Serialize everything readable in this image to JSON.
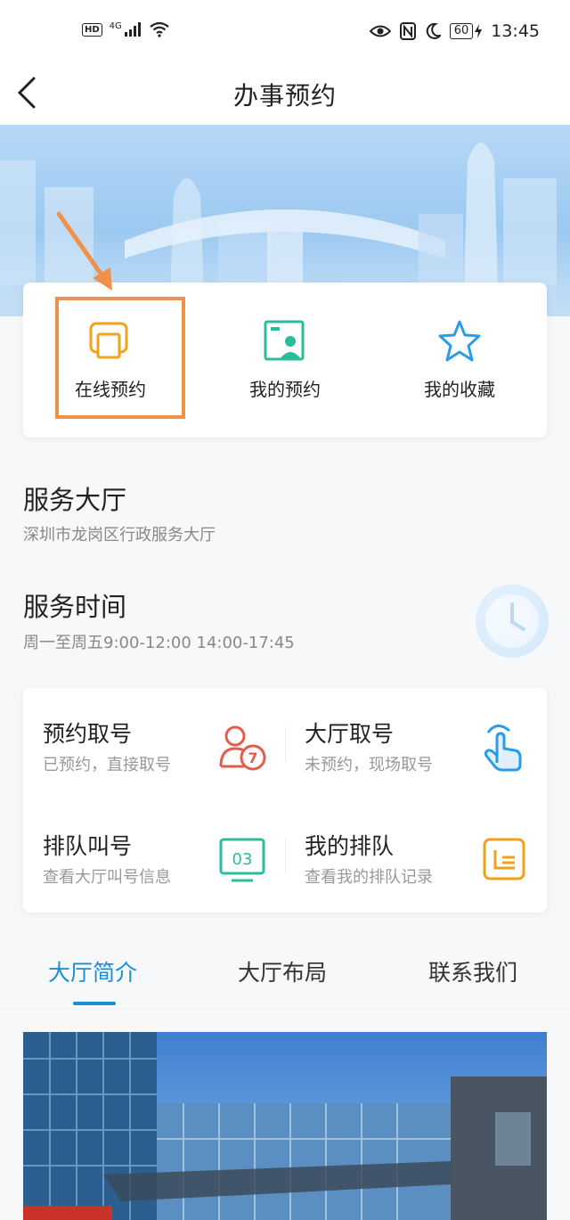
{
  "status_bar": {
    "hd": "HD",
    "network": "4G",
    "battery": "60",
    "time": "13:45",
    "icons": [
      "hd-icon",
      "signal-icon",
      "wifi-icon",
      "eye-icon",
      "nfc-icon",
      "moon-icon",
      "battery-icon",
      "charging-icon"
    ]
  },
  "nav": {
    "title": "办事预约",
    "back_icon": "chevron-left-icon"
  },
  "quick_actions": [
    {
      "label": "在线预约",
      "icon": "booking-icon",
      "color": "#f0a21a"
    },
    {
      "label": "我的预约",
      "icon": "id-card-icon",
      "color": "#2bbd9a"
    },
    {
      "label": "我的收藏",
      "icon": "star-icon",
      "color": "#2a9de6"
    }
  ],
  "hall": {
    "title": "服务大厅",
    "name": "深圳市龙岗区行政服务大厅"
  },
  "hours": {
    "title": "服务时间",
    "value": "周一至周五9:00-12:00 14:00-17:45"
  },
  "services": [
    {
      "title": "预约取号",
      "subtitle": "已预约，直接取号",
      "icon": "ticket-person-icon",
      "icon_text": "7",
      "color": "#e35d4a"
    },
    {
      "title": "大厅取号",
      "subtitle": "未预约，现场取号",
      "icon": "hand-tap-icon",
      "color": "#2a9de6"
    },
    {
      "title": "排队叫号",
      "subtitle": "查看大厅叫号信息",
      "icon": "display-number-icon",
      "icon_text": "03",
      "color": "#2bbd9a"
    },
    {
      "title": "我的排队",
      "subtitle": "查看我的排队记录",
      "icon": "queue-record-icon",
      "color": "#f0a21a"
    }
  ],
  "tabs": [
    {
      "label": "大厅简介",
      "active": true
    },
    {
      "label": "大厅布局",
      "active": false
    },
    {
      "label": "联系我们",
      "active": false
    }
  ],
  "colors": {
    "accent": "#1a8fd6",
    "highlight": "#f0914a"
  }
}
